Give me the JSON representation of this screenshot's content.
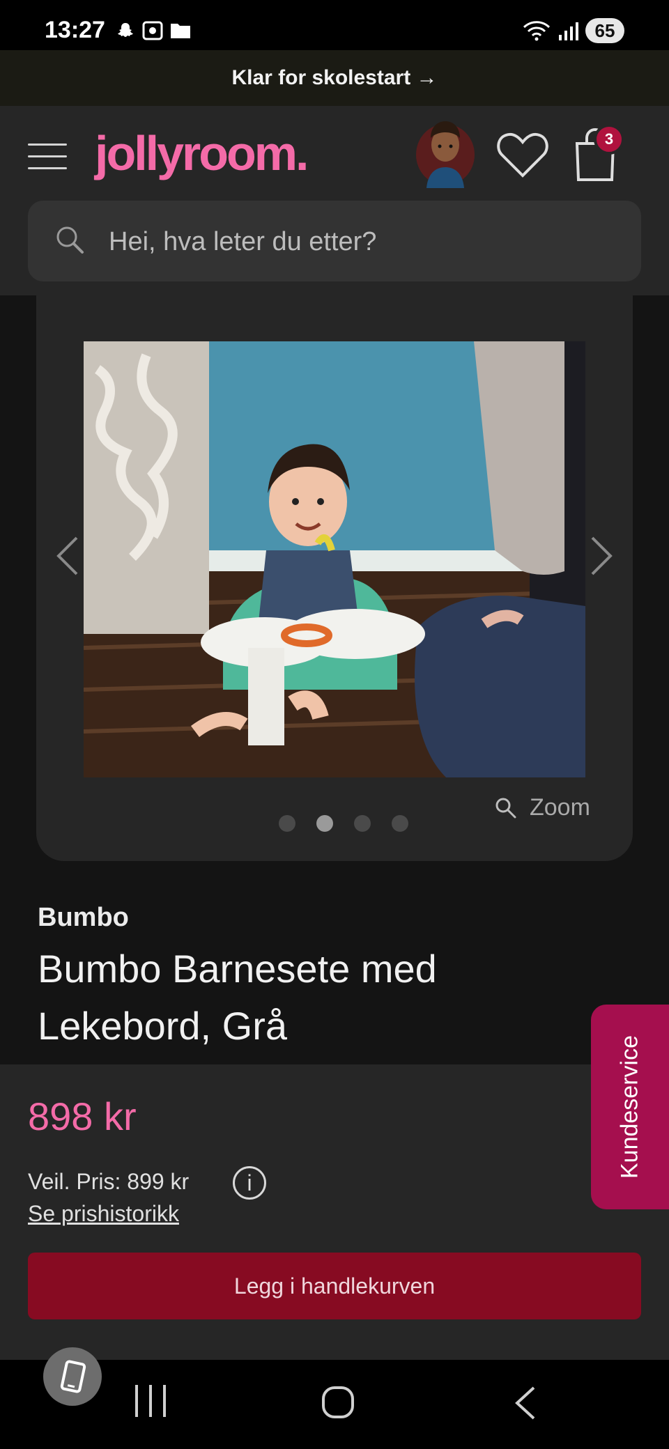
{
  "status_bar": {
    "time": "13:27",
    "battery": "65"
  },
  "promo": {
    "text": "Klar for skolestart →"
  },
  "header": {
    "logo": "jollyroom.",
    "cart_count": "3",
    "search_placeholder": "Hei, hva leter du etter?"
  },
  "gallery": {
    "zoom_label": "Zoom",
    "dots_count": 4,
    "active_dot": 2
  },
  "product": {
    "brand": "Bumbo",
    "title": "Bumbo Barnesete med Lekebord, Grå",
    "price": "898 kr",
    "recommended_price": "Veil. Pris: 899 kr",
    "info_symbol": "i",
    "price_history_link": "Se prishistorikk",
    "add_to_cart_label": "Legg i handlekurven"
  },
  "side_tab": {
    "label": "Kundeservice"
  },
  "icons": {
    "menu": "hamburger-menu-icon",
    "wishlist": "heart-icon",
    "cart": "shopping-bag-icon",
    "search": "search-icon",
    "zoom": "magnifier-icon"
  },
  "colors": {
    "brand_pink": "#f46ba8",
    "cta_red": "#870b22",
    "side_tab": "#a50f4e",
    "badge": "#b0123e"
  }
}
